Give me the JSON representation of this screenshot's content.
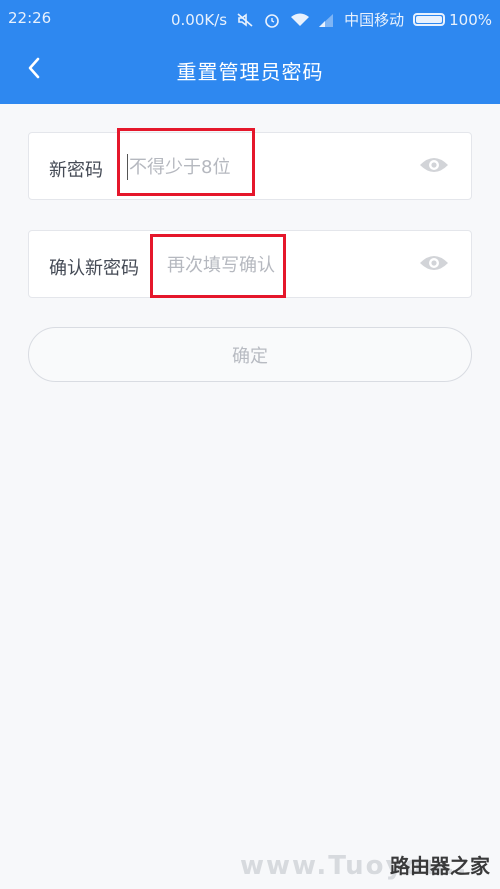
{
  "status_bar": {
    "time": "22:26",
    "net_speed": "0.00K/s",
    "carrier": "中国移动",
    "battery": "100%",
    "icons": [
      "mute-icon",
      "alarm-icon",
      "wifi-icon",
      "signal-icon",
      "battery-icon"
    ]
  },
  "nav": {
    "title": "重置管理员密码",
    "back_icon": "chevron-left-icon"
  },
  "form": {
    "new_password": {
      "label": "新密码",
      "placeholder": "不得少于8位",
      "value": "",
      "eye_icon": "eye-icon"
    },
    "confirm_password": {
      "label": "确认新密码",
      "placeholder": "再次填写确认",
      "value": "",
      "eye_icon": "eye-icon"
    },
    "submit_label": "确定"
  },
  "watermark": {
    "text": "路由器之家",
    "faint_text": "www.Tuoyou..."
  },
  "colors": {
    "primary": "#2e88f0",
    "highlight": "#e5172b",
    "background": "#f7f8fa"
  }
}
